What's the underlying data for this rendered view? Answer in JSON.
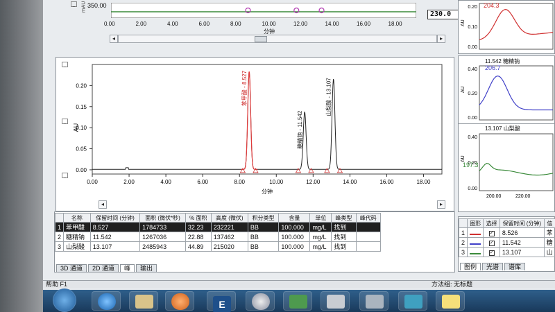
{
  "overview": {
    "y_value": "350.00",
    "x_ticks": [
      "0.00",
      "2.00",
      "4.00",
      "6.00",
      "8.00",
      "10.00",
      "12.00",
      "14.00",
      "16.00",
      "18.00"
    ],
    "xlabel": "分钟",
    "field_value": "230.0",
    "marker_label": "mAU"
  },
  "chromatogram": {
    "ylabel": "AU",
    "xlabel": "分钟",
    "y_ticks": [
      "0.20",
      "0.15",
      "0.10",
      "0.05",
      "0.00"
    ],
    "x_ticks": [
      "0.00",
      "2.00",
      "4.00",
      "6.00",
      "8.00",
      "10.00",
      "12.00",
      "14.00",
      "16.00",
      "18.00"
    ],
    "peaks": [
      {
        "label": "苯甲酸 - 8.527",
        "rt": 8.527,
        "height": 0.232,
        "color": "#e23b3b"
      },
      {
        "label": "糖精钠 - 11.542",
        "rt": 11.542,
        "height": 0.137,
        "color": "#222222"
      },
      {
        "label": "山梨酸 - 13.107",
        "rt": 13.107,
        "height": 0.215,
        "color": "#222222"
      }
    ]
  },
  "results_table": {
    "headers": [
      "名称",
      "保留时间 (分钟)",
      "面积 (微伏*秒)",
      "% 面积",
      "高度 (微伏)",
      "积分类型",
      "含量",
      "单位",
      "峰类型",
      "峰代码"
    ],
    "rows": [
      [
        "苯甲酸",
        "8.527",
        "1784733",
        "32.23",
        "232221",
        "BB",
        "100.000",
        "mg/L",
        "找到",
        ""
      ],
      [
        "糖精钠",
        "11.542",
        "1267036",
        "22.88",
        "137462",
        "BB",
        "100.000",
        "mg/L",
        "找到",
        ""
      ],
      [
        "山梨酸",
        "13.107",
        "2485943",
        "44.89",
        "215020",
        "BB",
        "100.000",
        "mg/L",
        "找到",
        ""
      ]
    ],
    "row_numbers": [
      "1",
      "2",
      "3"
    ]
  },
  "bottom_tabs": [
    "3D 通道",
    "2D 通道",
    "峰",
    "输出"
  ],
  "status": {
    "help": "帮助 F1",
    "method": "方法组: 无标题"
  },
  "right_panels": [
    {
      "peak_value": "204.3",
      "y_ticks": [
        "0.20",
        "0.10",
        "0.00"
      ],
      "ylabel": "AU"
    },
    {
      "title": "11.542 糖精钠",
      "peak_value": "206.7",
      "y_ticks": [
        "0.40",
        "0.20",
        "0.00"
      ],
      "ylabel": "AU"
    },
    {
      "title": "13.107 山梨酸",
      "peak_value": "197.3",
      "y_ticks": [
        "0.40",
        "0.20",
        "0.00"
      ],
      "ylabel": "AU",
      "x_ticks": [
        "200.00",
        "220.00"
      ]
    }
  ],
  "right_table": {
    "headers": [
      "图形",
      "选择",
      "保留时间 (分钟)",
      "信"
    ],
    "rows": [
      [
        "1",
        "8.526",
        "苯"
      ],
      [
        "2",
        "11.542",
        "糖"
      ],
      [
        "3",
        "13.107",
        "山"
      ]
    ]
  },
  "right_tabs": [
    "图例",
    "光谱",
    "谱库"
  ]
}
